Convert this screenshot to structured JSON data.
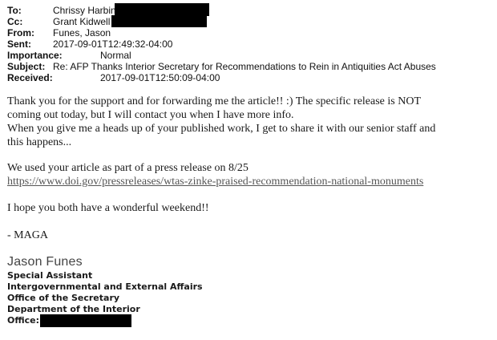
{
  "header": {
    "to_label": "To:",
    "to_value": "Chrissy Harbin",
    "cc_label": "Cc:",
    "cc_value": "Grant Kidwell",
    "from_label": "From:",
    "from_value": "Funes, Jason",
    "sent_label": "Sent:",
    "sent_value": "2017-09-01T12:49:32-04:00",
    "importance_label": "Importance:",
    "importance_value": "Normal",
    "subject_label": "Subject:",
    "subject_value": "Re: AFP Thanks Interior Secretary for Recommendations to Rein in Antiquities Act Abuses",
    "received_label": "Received:",
    "received_value": "2017-09-01T12:50:09-04:00"
  },
  "body": {
    "line1": "Thank you for the support and for forwarding me the article!! :) The specific release is NOT",
    "line2": "coming out today, but I will contact you when I have more info.",
    "line3": "When you give me a heads up of your published work, I get to share it with our senior staff and",
    "line4": "this happens...",
    "line5": "We used your article as part of a press release on 8/25",
    "link": "https://www.doi.gov/pressreleases/wtas-zinke-praised-recommendation-national-monuments",
    "line6": "I hope you both have a wonderful weekend!!",
    "line7": "- MAGA"
  },
  "signature": {
    "name": "Jason Funes",
    "title": "Special Assistant",
    "office1": "Intergovernmental and External Affairs",
    "office2": "Office of the Secretary",
    "dept": "Department of the Interior",
    "office_label": "Office:"
  },
  "colors": {
    "redaction": "#000000",
    "link": "#555555"
  }
}
